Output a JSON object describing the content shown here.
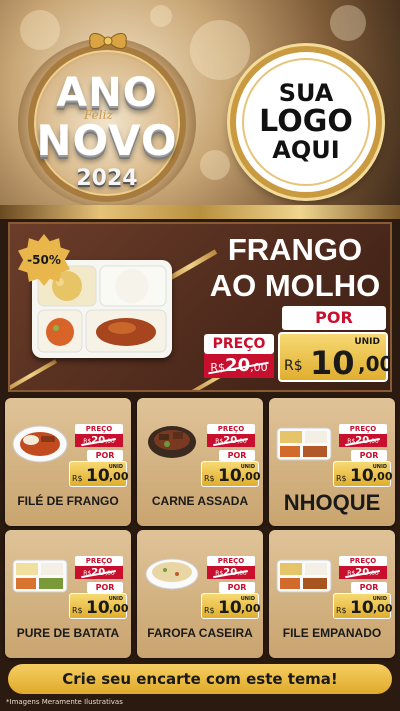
{
  "banner": {
    "badge": {
      "line1": "ANO",
      "script": "Feliz",
      "line2": "NOVO",
      "year": "2024"
    },
    "logo": {
      "line1": "SUA",
      "line2": "LOGO",
      "line3": "AQUI"
    }
  },
  "featured": {
    "discount": "-50%",
    "name_line1": "FRANGO",
    "name_line2": "AO MOLHO",
    "preco_label": "PREÇO",
    "old_currency": "R$",
    "old_price": "20",
    "old_cents": ",00",
    "por_label": "POR",
    "unid_label": "UNID",
    "new_currency": "R$",
    "new_price": "10",
    "new_cents": ",00"
  },
  "labels": {
    "preco": "PREÇO",
    "por": "POR",
    "unid": "UNID",
    "currency": "R$"
  },
  "products": [
    {
      "name": "FILÉ DE FRANGO",
      "old_price": "20",
      "old_cents": ",00",
      "new_price": "10",
      "new_cents": ",00"
    },
    {
      "name": "CARNE ASSADA",
      "old_price": "20",
      "old_cents": ",00",
      "new_price": "10",
      "new_cents": ",00"
    },
    {
      "name": "NHOQUE",
      "old_price": "20",
      "old_cents": ",00",
      "new_price": "10",
      "new_cents": ",00"
    },
    {
      "name": "PURE DE BATATA",
      "old_price": "20",
      "old_cents": ",00",
      "new_price": "10",
      "new_cents": ",00"
    },
    {
      "name": "FAROFA CASEIRA",
      "old_price": "20",
      "old_cents": ",00",
      "new_price": "10",
      "new_cents": ",00"
    },
    {
      "name": "FILE EMPANADO",
      "old_price": "20",
      "old_cents": ",00",
      "new_price": "10",
      "new_cents": ",00"
    }
  ],
  "cta": "Crie seu encarte com este tema!",
  "disclaimer": "*Imagens Meramente Ilustrativas",
  "colors": {
    "accent_red": "#c8102e",
    "gold": "#e0ae2e",
    "panel_brown": "#4e2a1c",
    "card_beige": "#d6b684"
  }
}
